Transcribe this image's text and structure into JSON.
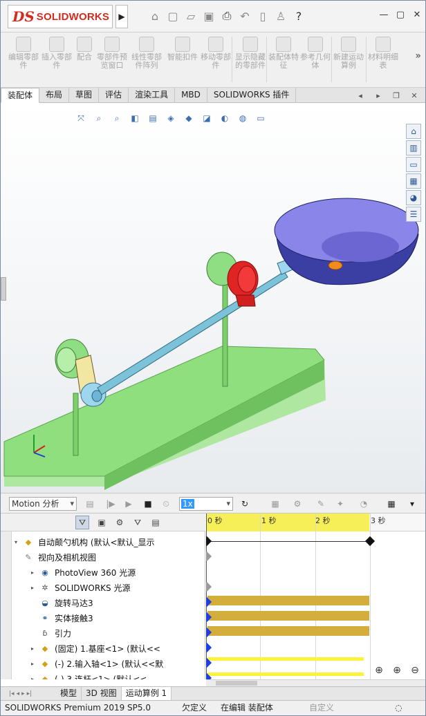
{
  "app": {
    "logo_mark": "DS",
    "logo_text": "SOLIDWORKS",
    "expand_arrow": "▶"
  },
  "ribbon": {
    "buttons": [
      "编辑零部件",
      "插入零部件",
      "配合",
      "零部件预览窗口",
      "线性零部件阵列",
      "智能扣件",
      "移动零部件",
      "显示隐藏的零部件",
      "装配体特征",
      "参考几何体",
      "新建运动算例",
      "材料明细表"
    ]
  },
  "tabs": [
    "装配体",
    "布局",
    "草图",
    "评估",
    "渲染工具",
    "MBD",
    "SOLIDWORKS 插件"
  ],
  "motion_toolbar": {
    "study_type": "Motion 分析",
    "speed": "1x"
  },
  "timeline": {
    "ticks": [
      "0 秒",
      "1 秒",
      "2 秒",
      "3 秒"
    ]
  },
  "tree": {
    "items": [
      {
        "label": "自动颠勺机构  (默认<默认_显示",
        "icon": "assembly-icon",
        "expand": "▾"
      },
      {
        "label": "视向及相机视图",
        "icon": "camera-icon",
        "expand": ""
      },
      {
        "label": "PhotoView 360 光源",
        "icon": "photoview-light-icon",
        "expand": "▸"
      },
      {
        "label": "SOLIDWORKS 光源",
        "icon": "light-icon",
        "expand": "▸"
      },
      {
        "label": "旋转马达3",
        "icon": "motor-icon",
        "expand": ""
      },
      {
        "label": "实体接触3",
        "icon": "contact-icon",
        "expand": ""
      },
      {
        "label": "引力",
        "icon": "gravity-icon",
        "expand": ""
      },
      {
        "label": "(固定) 1.基座<1> (默认<<",
        "icon": "part-icon",
        "expand": "▸"
      },
      {
        "label": "(-) 2.输入轴<1> (默认<<默",
        "icon": "part-icon",
        "expand": "▸"
      },
      {
        "label": "(-) 3.连杆<1> (默认<<",
        "icon": "part-icon",
        "expand": "▸"
      }
    ]
  },
  "bottom_tabs": [
    "模型",
    "3D 视图",
    "运动算例 1"
  ],
  "status": {
    "product": "SOLIDWORKS Premium 2019 SP5.0",
    "state1": "欠定义",
    "state2": "在编辑 装配体",
    "state3": "自定义"
  },
  "colors": {
    "brand_red": "#d52b1e",
    "timeline_yellow": "#f7ef58",
    "bar_gold": "#d4ae3c",
    "key_blue": "#1f3fe0"
  }
}
